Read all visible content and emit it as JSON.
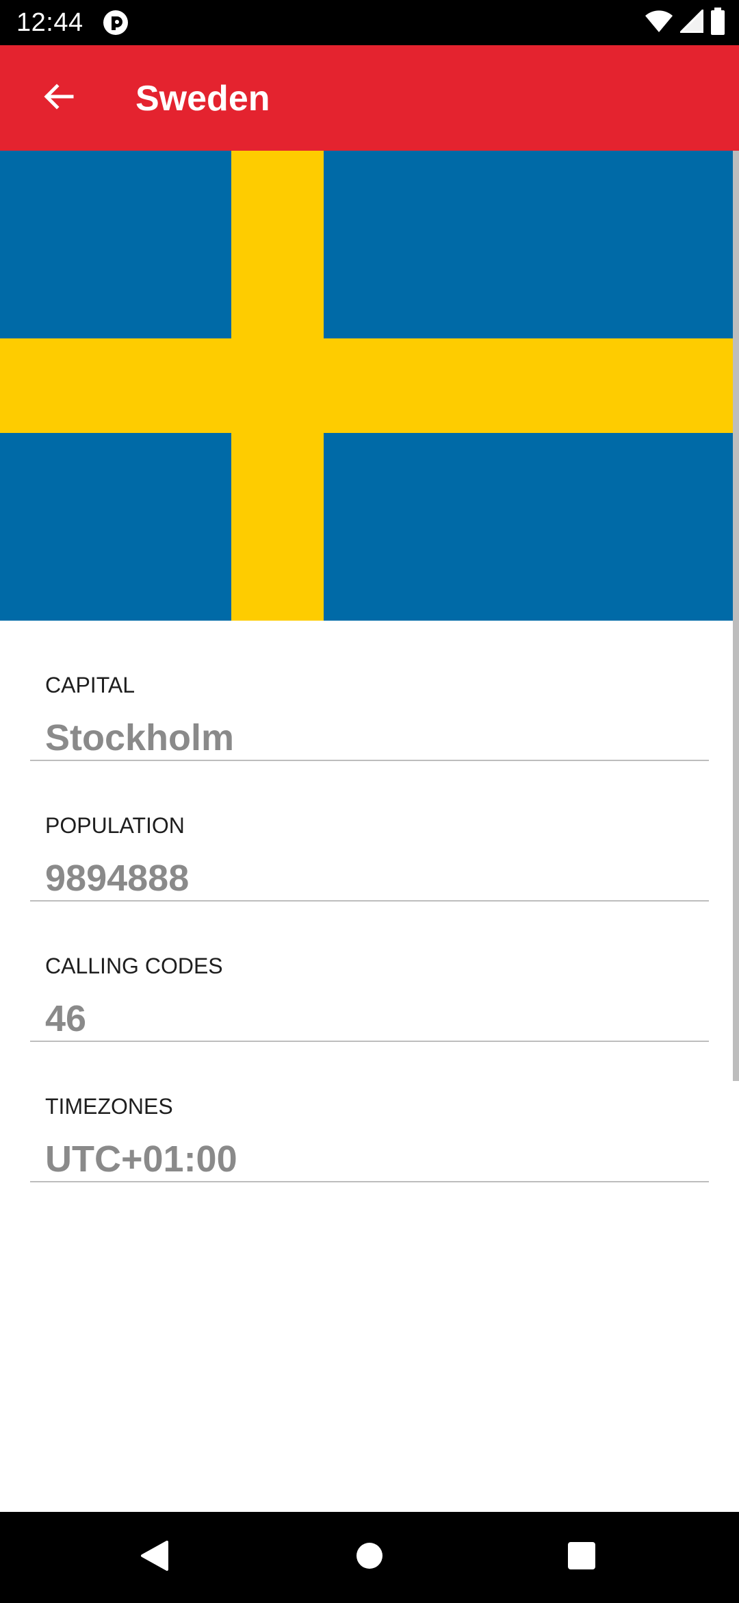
{
  "status_bar": {
    "time": "12:44",
    "icons": [
      "app-notification-icon",
      "wifi-icon",
      "cell-signal-icon",
      "battery-icon"
    ]
  },
  "app_bar": {
    "title": "Sweden",
    "back_icon": "arrow-back-icon",
    "color": "#e4232f"
  },
  "flag": {
    "country": "Sweden",
    "colors": {
      "blue": "#006aa7",
      "yellow": "#fecc00"
    }
  },
  "details": [
    {
      "label": "CAPITAL",
      "value": "Stockholm"
    },
    {
      "label": "POPULATION",
      "value": "9894888"
    },
    {
      "label": "CALLING CODES",
      "value": "46"
    },
    {
      "label": "TIMEZONES",
      "value": "UTC+01:00"
    }
  ],
  "nav_bar": {
    "buttons": [
      "back-triangle-icon",
      "home-circle-icon",
      "recents-square-icon"
    ]
  }
}
